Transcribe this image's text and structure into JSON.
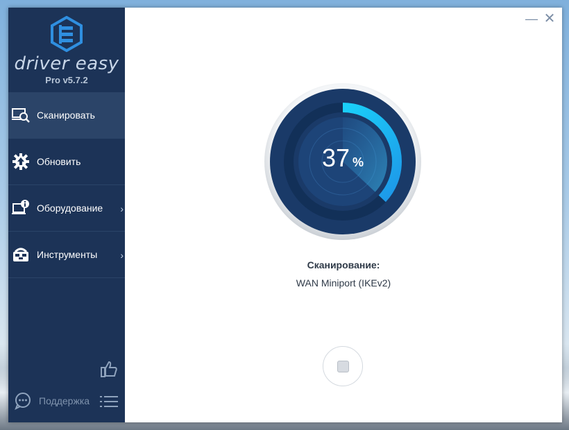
{
  "app": {
    "name": "driver easy",
    "version": "Pro v5.7.2"
  },
  "nav": [
    {
      "label": "Сканировать",
      "icon": "scan-icon",
      "active": true
    },
    {
      "label": "Обновить",
      "icon": "update-icon",
      "active": false
    },
    {
      "label": "Оборудование",
      "icon": "hardware-info-icon",
      "active": false,
      "chevron": "›"
    },
    {
      "label": "Инструменты",
      "icon": "tools-icon",
      "active": false,
      "chevron": "›"
    }
  ],
  "footer": {
    "support_label": "Поддержка"
  },
  "window_controls": {
    "minimize": "—",
    "close": "✕"
  },
  "progress": {
    "value": "37",
    "unit": "%",
    "fraction": 0.37
  },
  "scan": {
    "label": "Сканирование:",
    "current_item": "WAN Miniport (IKEv2)"
  },
  "colors": {
    "sidebar": "#1c3357",
    "sidebar_active": "#2b4468",
    "gauge_dark": "#1a3a68",
    "gauge_progress_start": "#1e8fe6",
    "gauge_progress_end": "#19e6ff"
  }
}
